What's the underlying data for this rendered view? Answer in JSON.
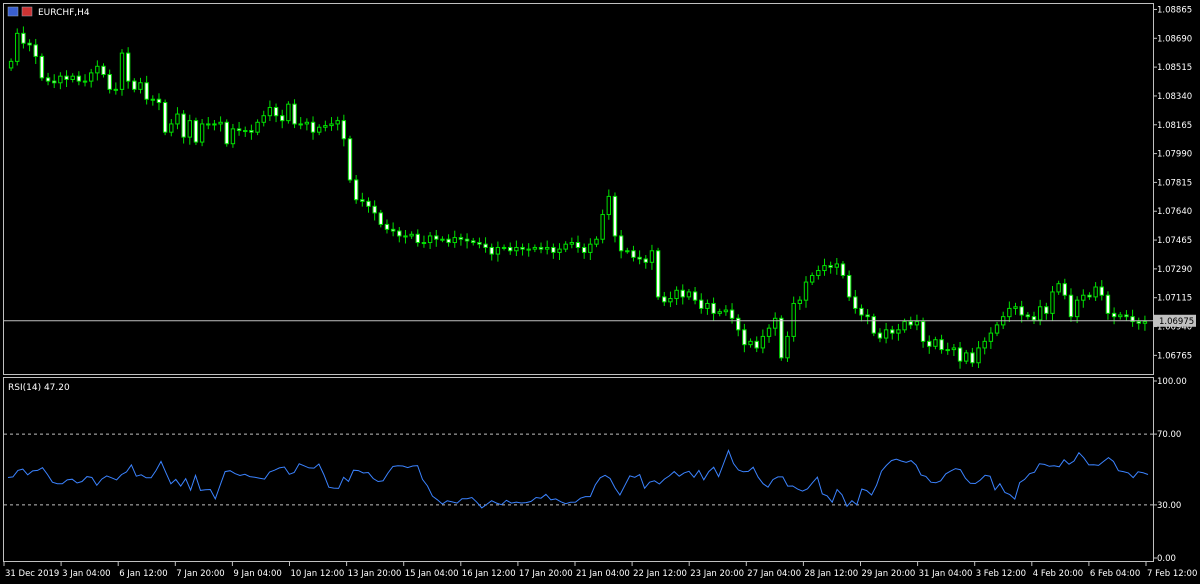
{
  "header": {
    "symbol": "EURCHF,H4"
  },
  "price_pane": {
    "axis_ticks": [
      "1.08865",
      "1.08690",
      "1.08515",
      "1.08340",
      "1.08165",
      "1.07990",
      "1.07815",
      "1.07640",
      "1.07465",
      "1.07290",
      "1.07115",
      "1.06940",
      "1.06765"
    ],
    "current_price": "1.06975"
  },
  "rsi_pane": {
    "label": "RSI(14) 47.20",
    "axis_ticks": [
      "100.00",
      "70.00",
      "30.00",
      "0.00"
    ]
  },
  "time_labels": [
    "31 Dec 2019",
    "3 Jan 04:00",
    "6 Jan 12:00",
    "7 Jan 20:00",
    "9 Jan 04:00",
    "10 Jan 12:00",
    "13 Jan 20:00",
    "15 Jan 04:00",
    "16 Jan 12:00",
    "17 Jan 20:00",
    "21 Jan 04:00",
    "22 Jan 12:00",
    "23 Jan 20:00",
    "27 Jan 04:00",
    "28 Jan 12:00",
    "29 Jan 20:00",
    "31 Jan 04:00",
    "3 Feb 12:00",
    "4 Feb 20:00",
    "6 Feb 04:00",
    "7 Feb 12:00"
  ],
  "colors": {
    "background": "#000000",
    "bull": "#00e000",
    "bear": "#00e000",
    "rsi_line": "#3b83ff",
    "grid_level": "#c0c0c0",
    "price_line": "#c0c0c0"
  },
  "chart_data": [
    {
      "type": "candlestick",
      "title": "EURCHF,H4",
      "x_start": "31 Dec 2019",
      "ylim": [
        1.0667,
        1.0888
      ],
      "close": [
        1.0855,
        1.0872,
        1.0866,
        1.0865,
        1.0858,
        1.0845,
        1.0843,
        1.0842,
        1.0846,
        1.0844,
        1.0846,
        1.0843,
        1.0843,
        1.0848,
        1.0852,
        1.0847,
        1.0838,
        1.0838,
        1.086,
        1.0843,
        1.0838,
        1.0842,
        1.0832,
        1.0832,
        1.083,
        1.0812,
        1.0817,
        1.0823,
        1.0809,
        1.0819,
        1.0806,
        1.0817,
        1.0817,
        1.0817,
        1.0818,
        1.0805,
        1.0814,
        1.0813,
        1.0813,
        1.0812,
        1.0818,
        1.0822,
        1.0827,
        1.0822,
        1.0819,
        1.0829,
        1.0817,
        1.0817,
        1.0818,
        1.0812,
        1.0815,
        1.0816,
        1.0817,
        1.0819,
        1.0808,
        1.0783,
        1.0771,
        1.077,
        1.0767,
        1.0763,
        1.0756,
        1.0753,
        1.0752,
        1.0749,
        1.0749,
        1.075,
        1.0745,
        1.0745,
        1.0749,
        1.0747,
        1.0747,
        1.0745,
        1.0748,
        1.0747,
        1.0746,
        1.0745,
        1.0744,
        1.0742,
        1.0738,
        1.0742,
        1.0742,
        1.074,
        1.0742,
        1.0741,
        1.0741,
        1.0742,
        1.0741,
        1.0742,
        1.0739,
        1.0741,
        1.0744,
        1.0745,
        1.0742,
        1.0739,
        1.0744,
        1.0747,
        1.0762,
        1.0773,
        1.0749,
        1.074,
        1.074,
        1.0736,
        1.0735,
        1.0733,
        1.074,
        1.0712,
        1.0709,
        1.0711,
        1.0716,
        1.0712,
        1.0715,
        1.071,
        1.0705,
        1.0708,
        1.0702,
        1.0703,
        1.0704,
        1.0699,
        1.0692,
        1.0683,
        1.0685,
        1.0681,
        1.0688,
        1.0693,
        1.0699,
        1.0675,
        1.0688,
        1.0708,
        1.071,
        1.0721,
        1.0725,
        1.0728,
        1.0731,
        1.073,
        1.0732,
        1.0725,
        1.0712,
        1.0705,
        1.0701,
        1.07,
        1.069,
        1.0687,
        1.0692,
        1.069,
        1.0692,
        1.0697,
        1.0695,
        1.0697,
        1.0685,
        1.0682,
        1.0686,
        1.068,
        1.068,
        1.0681,
        1.0673,
        1.0678,
        1.0672,
        1.0681,
        1.0685,
        1.069,
        1.0695,
        1.07,
        1.0705,
        1.0706,
        1.0701,
        1.07,
        1.0698,
        1.0706,
        1.0702,
        1.0715,
        1.072,
        1.0713,
        1.07,
        1.071,
        1.0713,
        1.0712,
        1.0718,
        1.0713,
        1.0702,
        1.07,
        1.0701,
        1.07,
        1.0697,
        1.0696,
        1.0697
      ],
      "y_ticks": [
        1.08865,
        1.0869,
        1.08515,
        1.0834,
        1.08165,
        1.0799,
        1.07815,
        1.0764,
        1.07465,
        1.0729,
        1.07115,
        1.0694,
        1.06765
      ],
      "current_price": 1.06975
    },
    {
      "type": "line",
      "title": "RSI(14) 47.20",
      "ylim": [
        0,
        100
      ],
      "levels": [
        30,
        70
      ],
      "values": [
        45.5,
        45.8,
        49.5,
        50.2,
        47.0,
        49.2,
        49.5,
        51.0,
        47.2,
        42.8,
        42.0,
        41.9,
        44.1,
        44.5,
        42.4,
        43.2,
        46.0,
        45.5,
        41.1,
        44.6,
        46.4,
        45.3,
        44.1,
        47.1,
        48.6,
        52.6,
        46.2,
        47.0,
        45.3,
        45.3,
        49.5,
        54.6,
        48.2,
        41.9,
        44.4,
        40.6,
        44.8,
        38.3,
        46.7,
        38.2,
        38.6,
        38.7,
        33.4,
        41.2,
        48.8,
        49.3,
        47.7,
        46.6,
        47.3,
        46.0,
        45.6,
        45.1,
        44.6,
        48.6,
        49.6,
        50.9,
        51.4,
        47.3,
        48.3,
        53.2,
        52.1,
        50.9,
        50.8,
        53.1,
        47.2,
        40.0,
        39.5,
        39.3,
        45.6,
        43.3,
        49.6,
        49.4,
        48.0,
        48.3,
        44.9,
        43.2,
        43.6,
        48.0,
        51.7,
        52.1,
        52.0,
        51.1,
        52.0,
        52.2,
        44.4,
        40.7,
        35.0,
        32.9,
        30.5,
        32.3,
        31.7,
        31.0,
        33.5,
        33.5,
        34.2,
        31.5,
        28.3,
        30.3,
        32.4,
        31.0,
        30.1,
        32.6,
        31.0,
        31.6,
        31.1,
        31.3,
        32.0,
        34.2,
        33.8,
        36.0,
        32.9,
        33.4,
        31.8,
        30.7,
        31.5,
        31.6,
        33.8,
        34.7,
        34.7,
        41.3,
        45.3,
        46.7,
        44.9,
        39.6,
        35.6,
        41.1,
        46.4,
        45.6,
        47.1,
        39.4,
        42.8,
        43.6,
        41.8,
        44.6,
        46.4,
        48.8,
        46.2,
        48.1,
        49.0,
        45.6,
        49.5,
        44.2,
        48.8,
        51.3,
        46.0,
        53.4,
        60.8,
        53.4,
        49.7,
        48.7,
        48.9,
        51.3,
        45.7,
        42.0,
        40.0,
        44.3,
        45.8,
        45.8,
        40.6,
        40.7,
        38.9,
        37.8,
        39.1,
        42.5,
        45.7,
        36.2,
        35.1,
        31.5,
        38.7,
        35.7,
        29.2,
        32.4,
        30.1,
        39.0,
        38.1,
        35.6,
        41.2,
        49.1,
        52.3,
        55.0,
        55.9,
        54.8,
        54.0,
        55.0,
        52.5,
        46.9,
        46.1,
        42.8,
        42.5,
        43.6,
        47.5,
        49.1,
        50.5,
        49.9,
        45.1,
        42.2,
        42.1,
        44.0,
        46.7,
        46.2,
        38.5,
        42.0,
        37.0,
        35.8,
        33.3,
        42.6,
        44.4,
        47.6,
        48.5,
        53.2,
        52.9,
        51.8,
        52.1,
        51.5,
        55.5,
        53.0,
        54.8,
        59.5,
        56.6,
        52.6,
        52.7,
        52.3,
        54.6,
        56.7,
        54.5,
        49.3,
        48.8,
        48.1,
        45.4,
        48.7,
        48.2,
        47.2
      ],
      "y_ticks": [
        100,
        70,
        30,
        0
      ]
    }
  ]
}
